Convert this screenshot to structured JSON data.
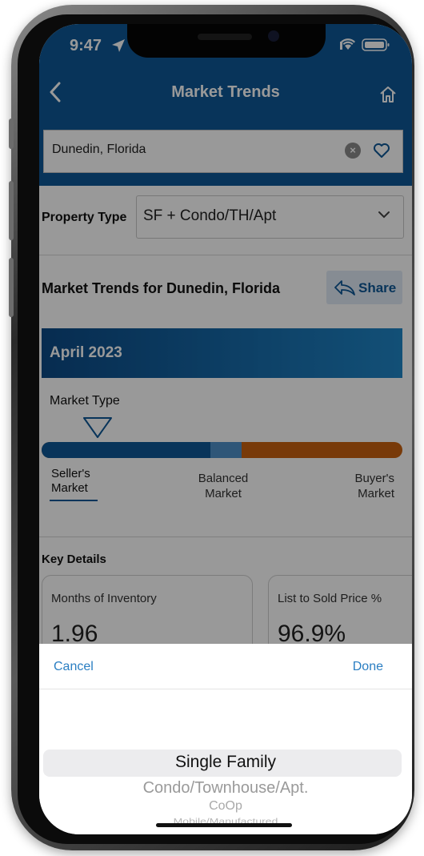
{
  "status": {
    "time": "9:47"
  },
  "nav": {
    "title": "Market Trends"
  },
  "search": {
    "value": "Dunedin, Florida"
  },
  "property_type": {
    "label": "Property Type",
    "value": "SF + Condo/TH/Apt"
  },
  "market_trends": {
    "title": "Market Trends for Dunedin, Florida",
    "share_label": "Share",
    "month": "April 2023",
    "market_type_label": "Market Type",
    "gauge": {
      "seller_fraction": 0.467,
      "balanced_fraction": 0.086,
      "colors": {
        "seller": "#0e5896",
        "balanced": "#4f8fc9",
        "buyer": "#c9620f"
      }
    },
    "labels": {
      "seller": [
        "Seller's",
        "Market"
      ],
      "balanced": [
        "Balanced",
        "Market"
      ],
      "buyer": [
        "Buyer's",
        "Market"
      ]
    }
  },
  "key_details": {
    "title": "Key Details",
    "cards": [
      {
        "label": "Months of Inventory",
        "value": "1.96"
      },
      {
        "label": "List to Sold Price %",
        "value": "96.9%"
      }
    ]
  },
  "picker": {
    "cancel": "Cancel",
    "done": "Done",
    "options": [
      "Single Family",
      "Condo/Townhouse/Apt.",
      "CoOp",
      "Mobile/Manufactured"
    ],
    "selected_index": 0
  },
  "colors": {
    "brand": "#0e5896",
    "link": "#2a7ec2"
  }
}
